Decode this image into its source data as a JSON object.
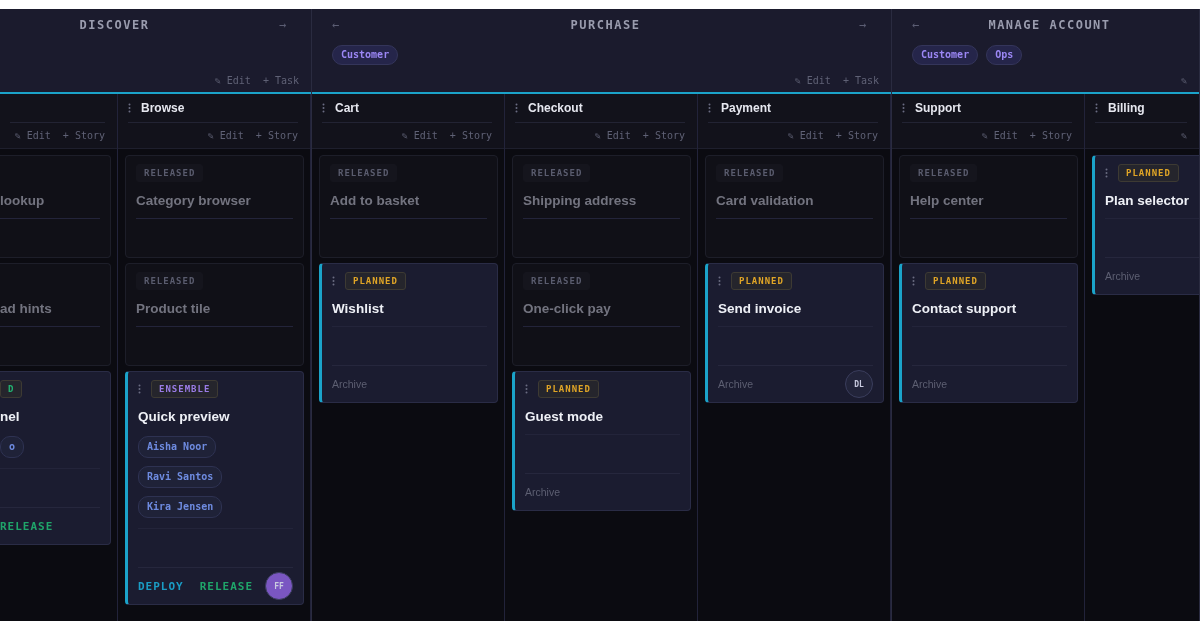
{
  "activities": [
    {
      "title": "DISCOVER",
      "clipped_left": true,
      "arrow_right": "→",
      "actions": [
        "✎ Edit",
        "+ Task"
      ],
      "columns": [
        {
          "clipped_left": true,
          "actions": [
            "✎ Edit",
            "+ Story"
          ],
          "cards": [
            {
              "kind": "released",
              "title": "lookup"
            },
            {
              "kind": "released",
              "title": "ad hints"
            },
            {
              "kind": "active",
              "badge": {
                "text": "D",
                "color": "#22b573"
              },
              "title": "nel",
              "chips": [
                "o"
              ],
              "links": [
                {
                  "label": "RELEASE",
                  "color": "#1fa56a"
                }
              ]
            }
          ]
        },
        {
          "title": "Browse",
          "actions": [
            "✎ Edit",
            "+ Story"
          ],
          "cards": [
            {
              "kind": "released",
              "badge": {
                "text": "RELEASED",
                "color": "#5a5c6e"
              },
              "title": "Category browser"
            },
            {
              "kind": "released",
              "badge": {
                "text": "RELEASED",
                "color": "#5a5c6e"
              },
              "title": "Product tile"
            },
            {
              "kind": "active",
              "badge": {
                "text": "ENSEMBLE",
                "color": "#9a7ce6"
              },
              "title": "Quick preview",
              "chips": [
                "Aisha Noor",
                "Ravi Santos",
                "Kira Jensen"
              ],
              "links": [
                {
                  "label": "DEPLOY",
                  "color": "#1a9cc4"
                },
                {
                  "label": "RELEASE",
                  "color": "#1fa56a"
                }
              ],
              "avatar": {
                "initials": "FF",
                "color": "#7a56c2"
              }
            }
          ]
        }
      ]
    },
    {
      "title": "PURCHASE",
      "arrow_left": "←",
      "arrow_right": "→",
      "tags": [
        "Customer"
      ],
      "actions": [
        "✎ Edit",
        "+ Task"
      ],
      "columns": [
        {
          "title": "Cart",
          "actions": [
            "✎ Edit",
            "+ Story"
          ],
          "cards": [
            {
              "kind": "released",
              "badge": {
                "text": "RELEASED",
                "color": "#5a5c6e"
              },
              "title": "Add to basket"
            },
            {
              "kind": "active",
              "badge": {
                "text": "PLANNED",
                "color": "#e0a526"
              },
              "title": "Wishlist",
              "footer": "Archive"
            }
          ]
        },
        {
          "title": "Checkout",
          "actions": [
            "✎ Edit",
            "+ Story"
          ],
          "cards": [
            {
              "kind": "released",
              "badge": {
                "text": "RELEASED",
                "color": "#5a5c6e"
              },
              "title": "Shipping address"
            },
            {
              "kind": "released",
              "badge": {
                "text": "RELEASED",
                "color": "#5a5c6e"
              },
              "title": "One-click pay"
            },
            {
              "kind": "active",
              "badge": {
                "text": "PLANNED",
                "color": "#e0a526"
              },
              "title": "Guest mode",
              "footer": "Archive"
            }
          ]
        },
        {
          "title": "Payment",
          "actions": [
            "✎ Edit",
            "+ Story"
          ],
          "cards": [
            {
              "kind": "released",
              "badge": {
                "text": "RELEASED",
                "color": "#5a5c6e"
              },
              "title": "Card validation"
            },
            {
              "kind": "active",
              "badge": {
                "text": "PLANNED",
                "color": "#e0a526"
              },
              "title": "Send invoice",
              "footer": "Archive",
              "avatar": {
                "initials": "DL",
                "color": "#22243a"
              }
            }
          ]
        }
      ]
    },
    {
      "title": "MANAGE ACCOUNT",
      "arrow_left": "←",
      "tags": [
        "Customer",
        "Ops"
      ],
      "actions": [
        "✎"
      ],
      "columns": [
        {
          "title": "Support",
          "actions": [
            "✎ Edit",
            "+ Story"
          ],
          "cards": [
            {
              "kind": "released",
              "badge": {
                "text": "RELEASED",
                "color": "#5a5c6e"
              },
              "title": "Help center"
            },
            {
              "kind": "active",
              "badge": {
                "text": "PLANNED",
                "color": "#e0a526"
              },
              "title": "Contact support",
              "footer": "Archive"
            }
          ]
        },
        {
          "clipped_right": true,
          "title": "Billing",
          "actions": [
            "✎"
          ],
          "cards": [
            {
              "kind": "active",
              "badge": {
                "text": "PLANNED",
                "color": "#e0a526"
              },
              "title": "Plan selector",
              "footer": "Archive"
            }
          ]
        }
      ]
    }
  ]
}
